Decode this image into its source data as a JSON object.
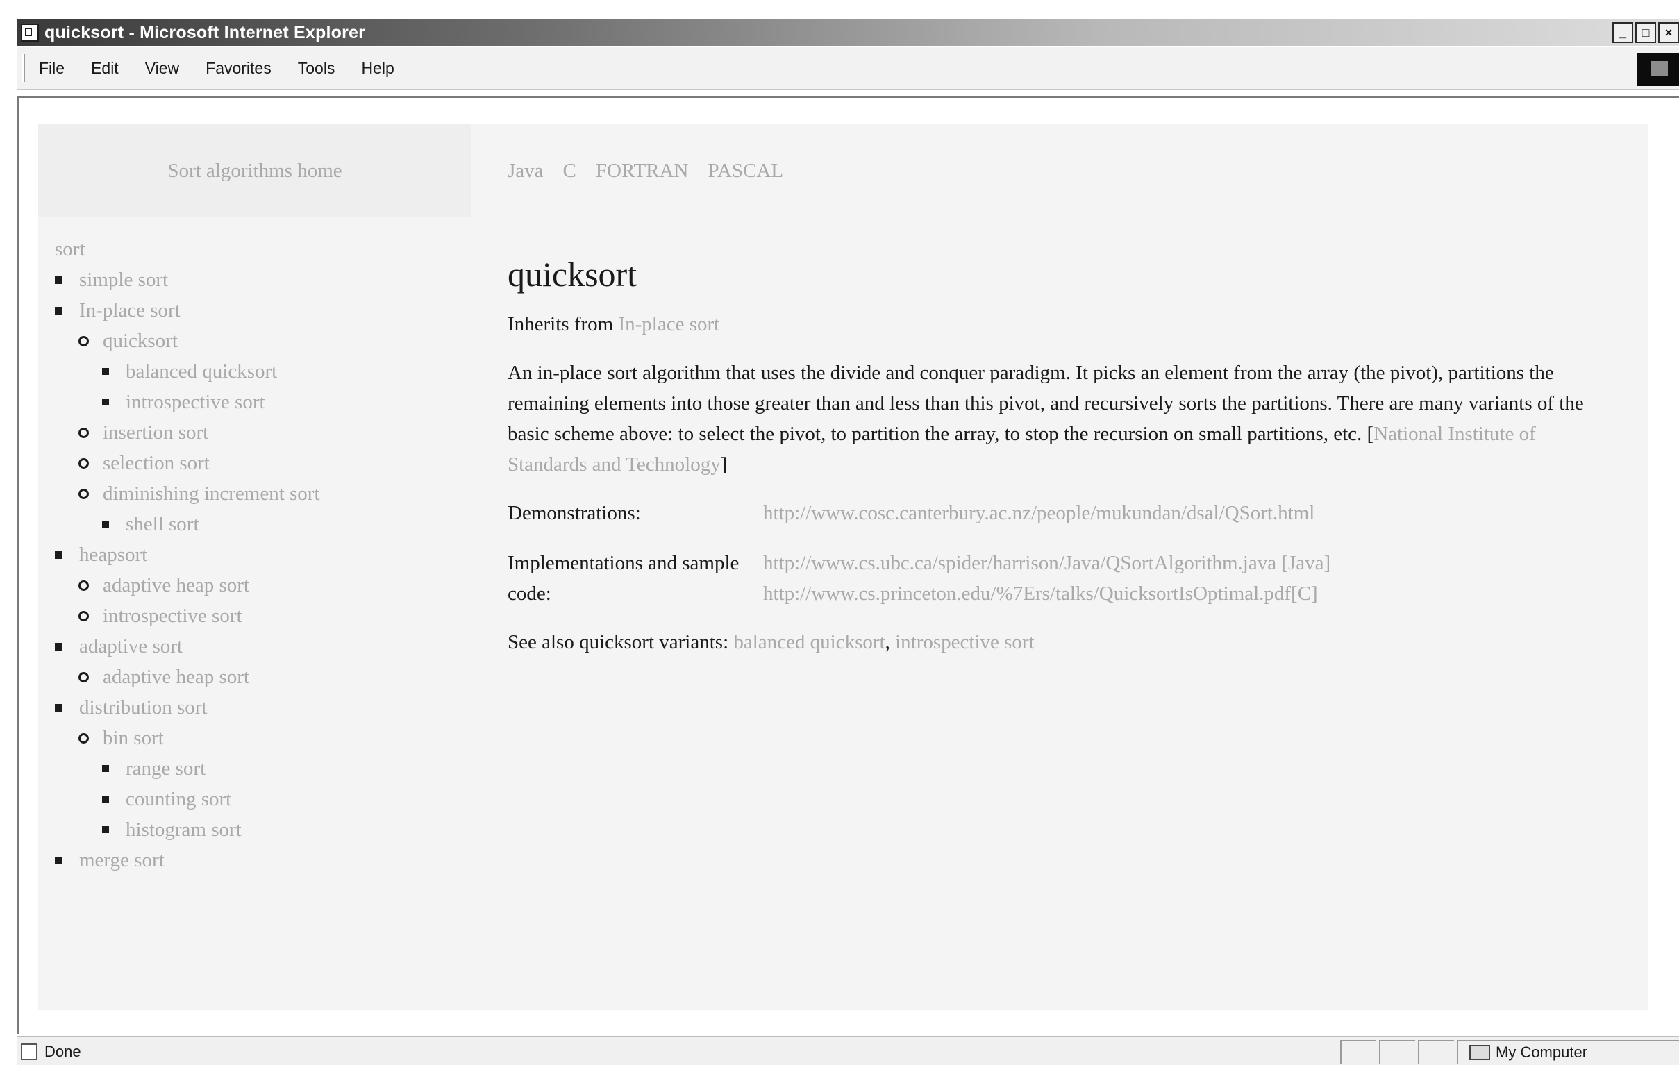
{
  "window": {
    "title": "quicksort - Microsoft Internet Explorer",
    "controls": [
      "_",
      "□",
      "×"
    ]
  },
  "menu": {
    "items": [
      "File",
      "Edit",
      "View",
      "Favorites",
      "Tools",
      "Help"
    ]
  },
  "top_nav": {
    "home_link": "Sort algorithms home",
    "languages": [
      "Java",
      "C",
      "FORTRAN",
      "PASCAL"
    ]
  },
  "sidebar": {
    "root": "sort",
    "items": [
      {
        "label": "simple sort",
        "level": 0
      },
      {
        "label": "In-place sort",
        "level": 0
      },
      {
        "label": "quicksort",
        "level": 1
      },
      {
        "label": "balanced quicksort",
        "level": 2
      },
      {
        "label": "introspective sort",
        "level": 2
      },
      {
        "label": "insertion sort",
        "level": 1
      },
      {
        "label": "selection sort",
        "level": 1
      },
      {
        "label": "diminishing increment sort",
        "level": 1
      },
      {
        "label": "shell sort",
        "level": 2
      },
      {
        "label": "heapsort",
        "level": 0
      },
      {
        "label": "adaptive heap sort",
        "level": 1
      },
      {
        "label": "introspective sort",
        "level": 1
      },
      {
        "label": "adaptive sort",
        "level": 0
      },
      {
        "label": "adaptive heap sort",
        "level": 1
      },
      {
        "label": "distribution sort",
        "level": 0
      },
      {
        "label": "bin sort",
        "level": 1
      },
      {
        "label": "range sort",
        "level": 2
      },
      {
        "label": "counting sort",
        "level": 2
      },
      {
        "label": "histogram sort",
        "level": 2
      },
      {
        "label": "merge sort",
        "level": 0
      }
    ]
  },
  "content": {
    "title": "quicksort",
    "inherits_label": "Inherits from",
    "inherits_link": "In-place sort",
    "description": "An in-place sort algorithm that uses the divide and conquer paradigm. It picks an element from the array (the pivot), partitions the remaining elements into those greater than and less than this pivot, and recursively sorts the partitions. There are many variants of the basic scheme above: to select the pivot, to partition the array, to stop the recursion on small partitions, etc.",
    "description_source_open": "[",
    "description_source": "National Institute of Standards and Technology",
    "description_source_close": "]",
    "demonstrations_label": "Demonstrations:",
    "demonstrations_url": "http://www.cosc.canterbury.ac.nz/people/mukundan/dsal/QSort.html",
    "implementations_label": "Implementations and sample code:",
    "implementations": [
      {
        "url": "http://www.cs.ubc.ca/spider/harrison/Java/QSortAlgorithm.java",
        "tag": "[Java]"
      },
      {
        "url": "http://www.cs.princeton.edu/%7Ers/talks/QuicksortIsOptimal.pdf",
        "tag": "[C]"
      }
    ],
    "see_also_label": "See also quicksort variants:",
    "see_also_links": [
      "balanced quicksort",
      "introspective sort"
    ],
    "see_also_sep": ","
  },
  "status": {
    "text": "Done",
    "zone": "My Computer"
  }
}
